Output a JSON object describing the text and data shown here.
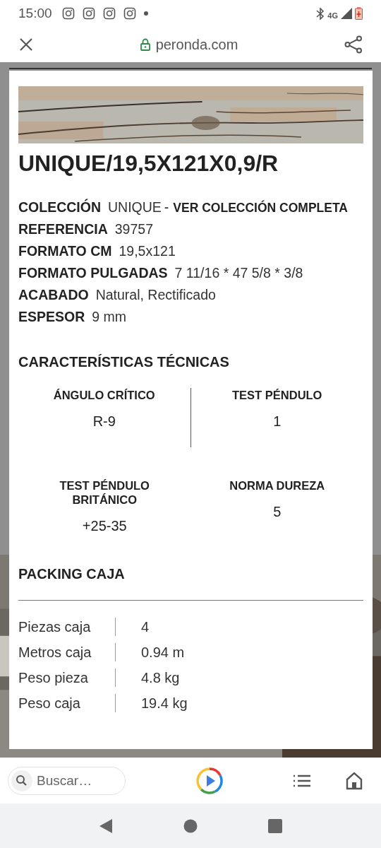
{
  "status_bar": {
    "time": "15:00",
    "network": "4G"
  },
  "browser": {
    "url": "peronda.com"
  },
  "product": {
    "title": "UNIQUE/19,5X121X0,9/R",
    "specs": [
      {
        "label": "COLECCIÓN",
        "value": "UNIQUE",
        "separator": "-",
        "link": "VER COLECCIÓN COMPLETA"
      },
      {
        "label": "REFERENCIA",
        "value": "39757"
      },
      {
        "label": "FORMATO CM",
        "value": "19,5x121"
      },
      {
        "label": "FORMATO PULGADAS",
        "value": "7 11/16 * 47 5/8 * 3/8"
      },
      {
        "label": "ACABADO",
        "value": "Natural, Rectificado"
      },
      {
        "label": "ESPESOR",
        "value": "9 mm"
      }
    ]
  },
  "technical": {
    "heading": "CARACTERÍSTICAS TÉCNICAS",
    "items": [
      {
        "label": "ÁNGULO CRÍTICO",
        "value": "R-9"
      },
      {
        "label": "TEST PÉNDULO",
        "value": "1"
      },
      {
        "label": "TEST PÉNDULO BRITÁNICO",
        "value": "+25-35"
      },
      {
        "label": "NORMA DUREZA",
        "value": "5"
      }
    ]
  },
  "packing": {
    "heading": "PACKING CAJA",
    "rows": [
      {
        "label": "Piezas caja",
        "value": "4"
      },
      {
        "label": "Metros caja",
        "value": "0.94 m"
      },
      {
        "label": "Peso pieza",
        "value": "4.8 kg"
      },
      {
        "label": "Peso caja",
        "value": "19.4 kg"
      }
    ]
  },
  "bottom_bar": {
    "search_placeholder": "Buscar…"
  }
}
